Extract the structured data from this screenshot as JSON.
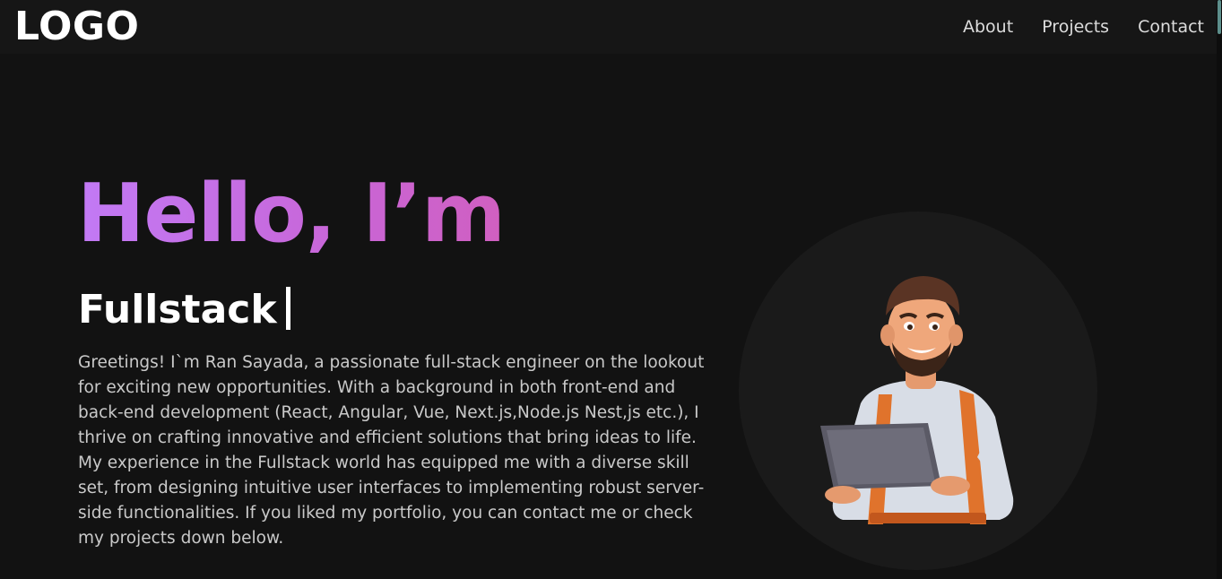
{
  "header": {
    "logo": "LOGO",
    "nav": [
      {
        "label": "About"
      },
      {
        "label": "Projects"
      },
      {
        "label": "Contact"
      }
    ]
  },
  "hero": {
    "title": "Hello, I’m",
    "role": "Fullstack",
    "intro": "Greetings! I`m Ran Sayada, a passionate full-stack engineer on the lookout for exciting new opportunities. With a background in both front-end and back-end development (React, Angular, Vue, Next.js,Node.js Nest,js etc.), I thrive on crafting innovative and efficient solutions that bring ideas to life. My experience in the Fullstack world has equipped me with a diverse skill set, from designing intuitive user interfaces to implementing robust server-side functionalities. If you liked my portfolio, you can contact me or check my projects down below.",
    "gradient_colors": [
      "#c27af5",
      "#d05fc0"
    ]
  },
  "avatar": {
    "icon": "developer-with-laptop-illustration"
  },
  "colors": {
    "background": "#121212",
    "header_background": "#161616",
    "text": "#ffffff",
    "body_text": "#c9c9c9"
  }
}
